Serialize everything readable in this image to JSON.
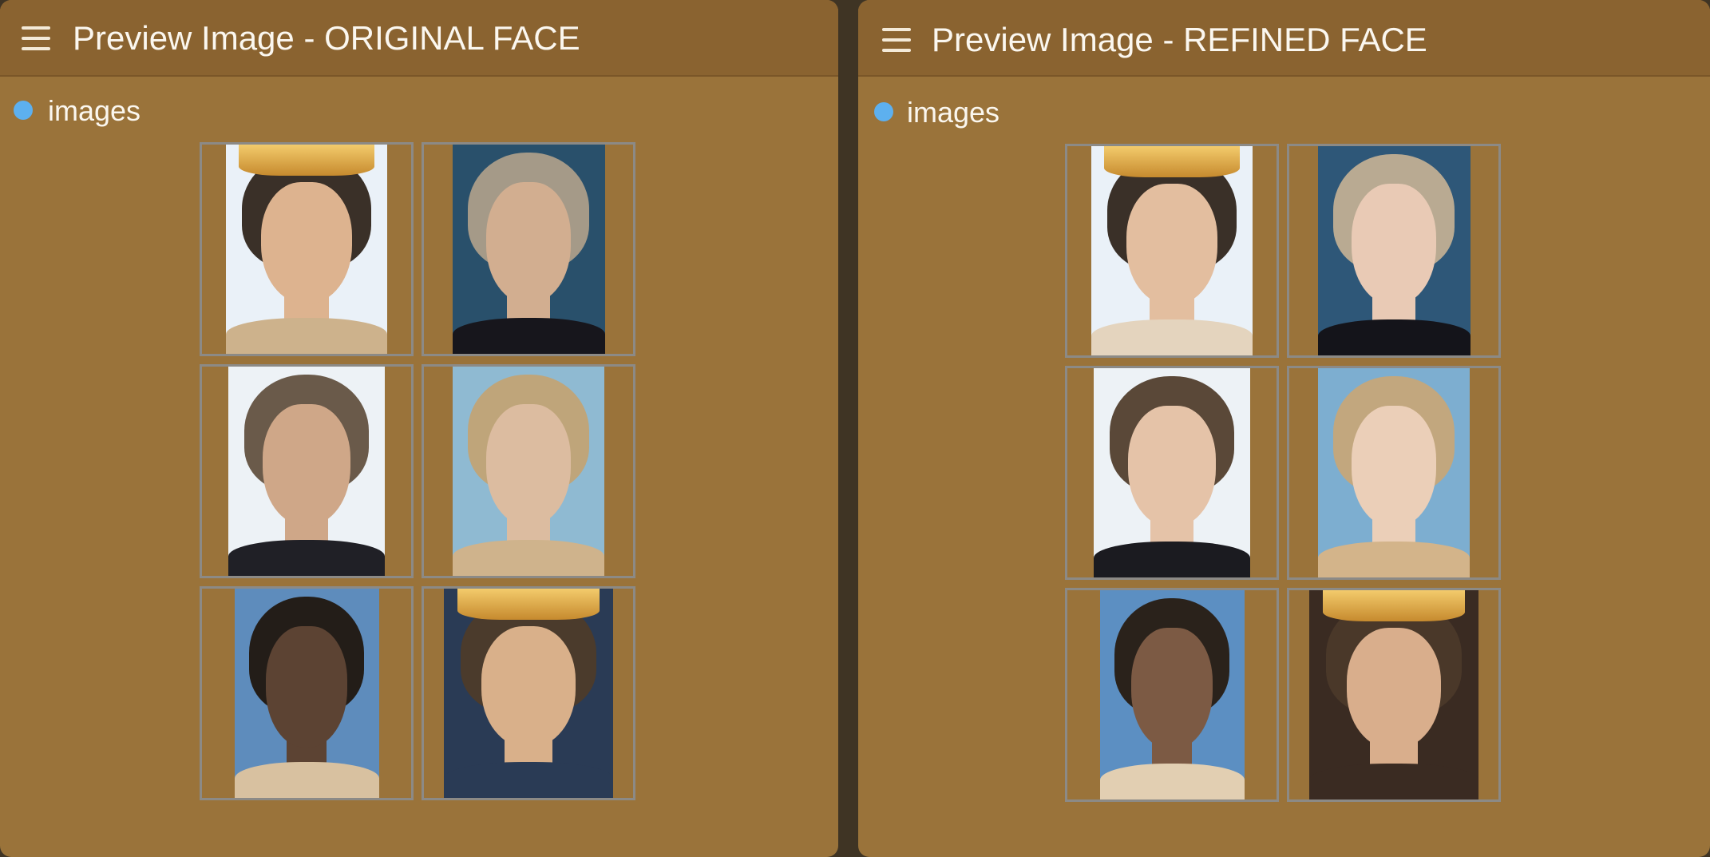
{
  "nodes": [
    {
      "title": "Preview Image - ORIGINAL FACE",
      "output_label": "images",
      "colors": {
        "header": "#8a6330",
        "body": "#9a733a",
        "output_dot": "#5db0ef"
      },
      "images": [
        {
          "name": "original-face-1",
          "skin": "#ddb38f",
          "hair": "#3a3028",
          "bg": "#eaf1f8",
          "collar": "#cdb28c",
          "crown": true
        },
        {
          "name": "original-face-2",
          "skin": "#d2ae90",
          "hair": "#a59a88",
          "bg": "#29506b",
          "collar": "#17161c",
          "crown": false
        },
        {
          "name": "original-face-3",
          "skin": "#cfa788",
          "hair": "#6a5a4a",
          "bg": "#edf2f6",
          "collar": "#202026",
          "crown": false
        },
        {
          "name": "original-face-4",
          "skin": "#dcbca0",
          "hair": "#bfa57a",
          "bg": "#8fbad2",
          "collar": "#cfb38c",
          "crown": false
        },
        {
          "name": "original-face-5",
          "skin": "#5c4333",
          "hair": "#231d18",
          "bg": "#5e8cbc",
          "collar": "#d8c1a0",
          "crown": false
        },
        {
          "name": "original-face-6",
          "skin": "#d9b08a",
          "hair": "#4b3b2c",
          "bg": "#2a3b55",
          "collar": "#2a3b55",
          "crown": true
        }
      ]
    },
    {
      "title": "Preview Image - REFINED FACE",
      "output_label": "images",
      "colors": {
        "header": "#8a6330",
        "body": "#9a733a",
        "output_dot": "#5db0ef"
      },
      "images": [
        {
          "name": "refined-face-1",
          "skin": "#e3be9f",
          "hair": "#3a3028",
          "bg": "#eaf1f8",
          "collar": "#e4d4be",
          "crown": true
        },
        {
          "name": "refined-face-2",
          "skin": "#e9cab5",
          "hair": "#b9aa92",
          "bg": "#2e5778",
          "collar": "#14141a",
          "crown": false
        },
        {
          "name": "refined-face-3",
          "skin": "#e5c3a8",
          "hair": "#5a4838",
          "bg": "#edf2f6",
          "collar": "#1b1b20",
          "crown": false
        },
        {
          "name": "refined-face-4",
          "skin": "#ebcfb8",
          "hair": "#c2a77e",
          "bg": "#7daed0",
          "collar": "#d3b48a",
          "crown": false
        },
        {
          "name": "refined-face-5",
          "skin": "#7c5a44",
          "hair": "#2a221b",
          "bg": "#5c8fc2",
          "collar": "#e2cfb2",
          "crown": false
        },
        {
          "name": "refined-face-6",
          "skin": "#d9ae8c",
          "hair": "#4a3829",
          "bg": "#3a2b22",
          "collar": "#3a2b22",
          "crown": true
        }
      ]
    }
  ]
}
